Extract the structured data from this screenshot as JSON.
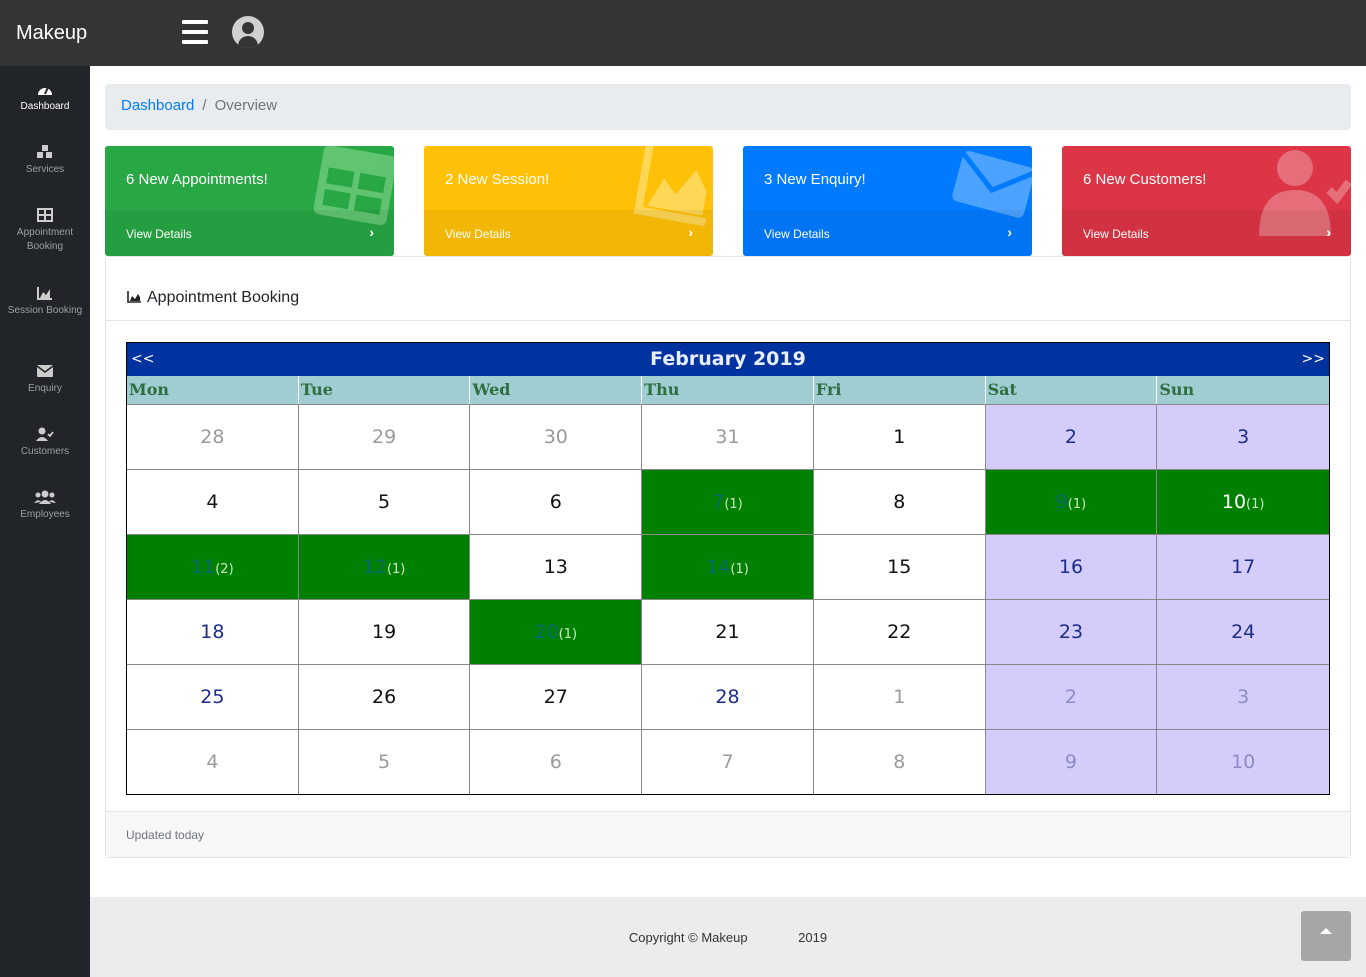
{
  "app": {
    "brand": "Makeup"
  },
  "sidebar": {
    "items": [
      {
        "label": "Dashboard",
        "icon": "tachometer-icon",
        "active": true
      },
      {
        "label": "Services",
        "icon": "cubes-icon"
      },
      {
        "label": "Appointment Booking",
        "icon": "table-icon"
      },
      {
        "label": "Session Booking",
        "icon": "area-chart-icon"
      },
      {
        "label": "Enquiry",
        "icon": "envelope-icon"
      },
      {
        "label": "Customers",
        "icon": "user-check-icon"
      },
      {
        "label": "Employees",
        "icon": "users-icon"
      }
    ]
  },
  "breadcrumb": {
    "root": "Dashboard",
    "current": "Overview"
  },
  "cards": [
    {
      "title": "6 New Appointments!",
      "link": "View Details",
      "color": "#28a745",
      "icon": "table-icon"
    },
    {
      "title": "2 New Session!",
      "link": "View Details",
      "color": "#ffc107",
      "icon": "area-chart-icon"
    },
    {
      "title": "3 New Enquiry!",
      "link": "View Details",
      "color": "#007bff",
      "icon": "envelope-icon"
    },
    {
      "title": "6 New Customers!",
      "link": "View Details",
      "color": "#dc3545",
      "icon": "user-check-icon"
    }
  ],
  "panel": {
    "title": "Appointment Booking",
    "updated": "Updated today"
  },
  "calendar": {
    "month": "February 2019",
    "prev": "<<",
    "next": ">>",
    "weekdays": [
      "Mon",
      "Tue",
      "Wed",
      "Thu",
      "Fri",
      "Sat",
      "Sun"
    ],
    "weeks": [
      [
        "28",
        "29",
        "30",
        "31",
        "1",
        "2",
        "3"
      ],
      [
        "4",
        "5",
        "6",
        "7",
        "8",
        "9",
        "10"
      ],
      [
        "11",
        "12",
        "13",
        "14",
        "15",
        "16",
        "17"
      ],
      [
        "18",
        "19",
        "20",
        "21",
        "22",
        "23",
        "24"
      ],
      [
        "25",
        "26",
        "27",
        "28",
        "1",
        "2",
        "3"
      ],
      [
        "4",
        "5",
        "6",
        "7",
        "8",
        "9",
        "10"
      ]
    ],
    "bookings": {
      "7": "(1)",
      "9": "(1)",
      "10": "(1)",
      "11": "(2)",
      "12": "(1)",
      "14": "(1)",
      "20": "(1)"
    }
  },
  "footer": {
    "copyright": "Copyright © Makeup",
    "year": "2019"
  }
}
